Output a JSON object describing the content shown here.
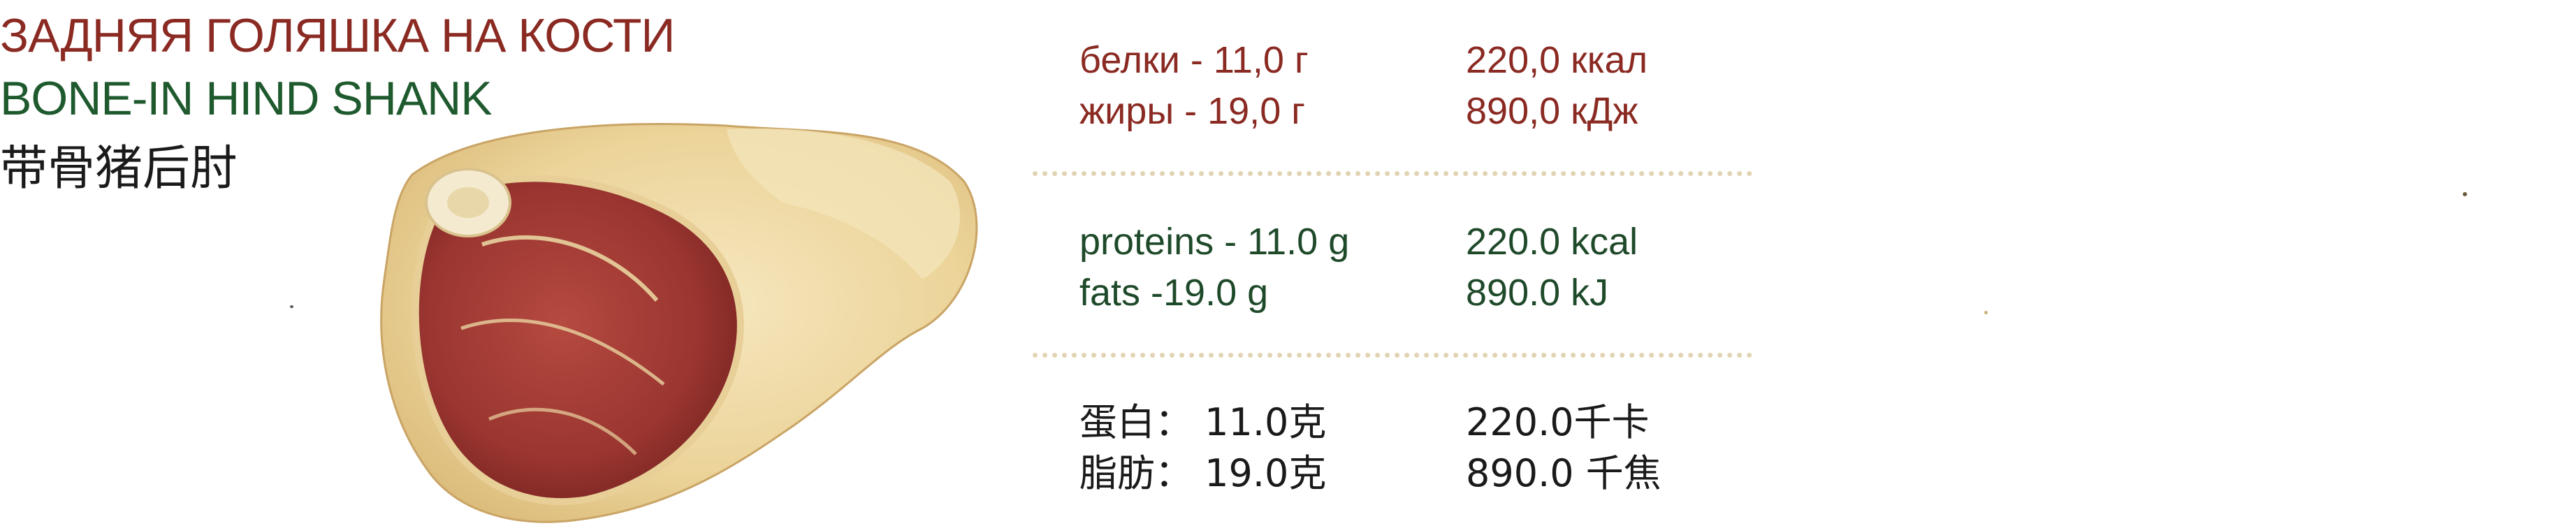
{
  "product": {
    "name_ru": "ЗАДНЯЯ ГОЛЯШКА НА КОСТИ",
    "name_en": "BONE-IN HIND SHANK",
    "name_cn": "带骨猪后肘"
  },
  "nutrition": {
    "ru": {
      "protein": "белки - 11,0 г",
      "fat": "жиры - 19,0 г",
      "kcal": "220,0 ккал",
      "kj": "890,0 кДж"
    },
    "en": {
      "protein": "proteins - 11.0 g",
      "fat": "fats -19.0 g",
      "kcal": "220.0 kcal",
      "kj": "890.0 kJ"
    },
    "cn": {
      "protein": "蛋白： 11.0克",
      "fat": "脂肪： 19.0克",
      "kcal": "220.0千卡",
      "kj": "890.0 千焦"
    }
  },
  "colors": {
    "russian_text": "#8a2a22",
    "english_text": "#1f4a2a",
    "chinese_text": "#1a1a1a",
    "divider": "#e1d3b3"
  }
}
